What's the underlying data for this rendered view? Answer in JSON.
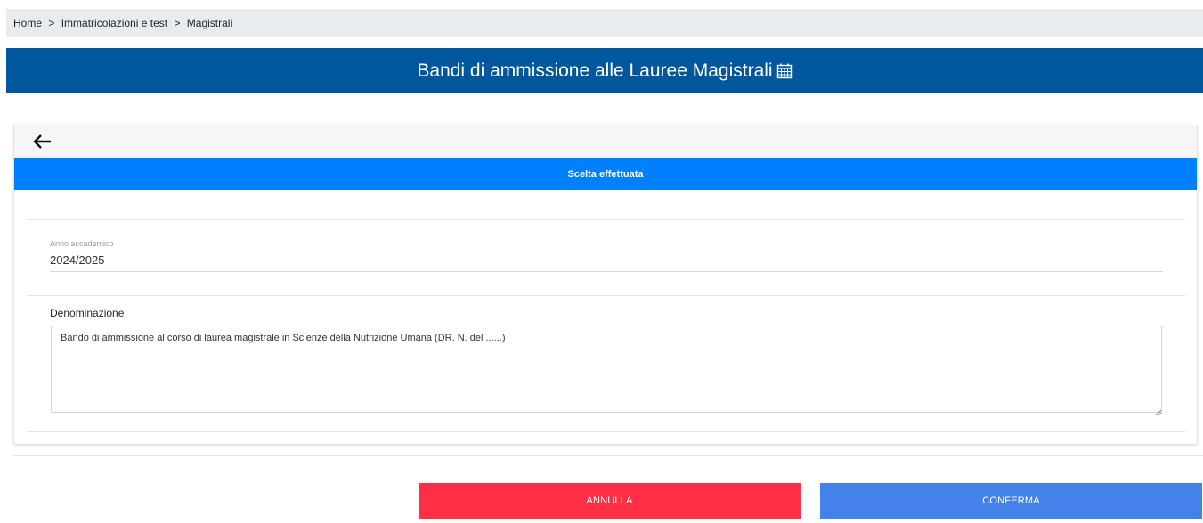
{
  "breadcrumb": {
    "items": [
      "Home",
      "Immatricolazioni e test",
      "Magistrali"
    ],
    "separator": ">"
  },
  "banner": {
    "title": "Bandi di ammissione alle Lauree Magistrali",
    "icon": "calendar-icon"
  },
  "card": {
    "back_icon": "arrow-left-icon",
    "section_title": "Scelta effettuata",
    "fields": {
      "anno_label": "Anno accademico",
      "anno_value": "2024/2025",
      "denominazione_label": "Denominazione",
      "denominazione_value": "Bando di ammissione al corso di laurea magistrale in Scienze della Nutrizione Umana (DR. N.  del ......)"
    }
  },
  "actions": {
    "cancel_label": "ANNULLA",
    "confirm_label": "CONFERMA"
  },
  "colors": {
    "banner": "#00579c",
    "section_header": "#0080ff",
    "cancel": "#ff3045",
    "confirm": "#4481eb"
  }
}
